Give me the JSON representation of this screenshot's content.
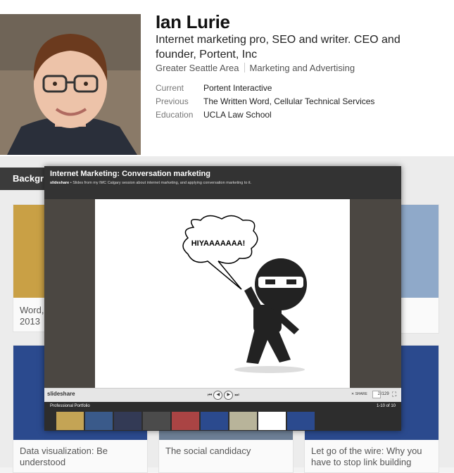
{
  "profile": {
    "name": "Ian Lurie",
    "headline": "Internet marketing pro, SEO and writer. CEO and founder, Portent, Inc",
    "location": "Greater Seattle Area",
    "industry": "Marketing and Advertising",
    "facts": [
      {
        "label": "Current",
        "value": "Portent Interactive"
      },
      {
        "label": "Previous",
        "value": "The Written Word, Cellular Technical Services"
      },
      {
        "label": "Education",
        "value": "UCLA Law School"
      }
    ]
  },
  "background": {
    "tab_label": "Backgr",
    "cards": [
      {
        "text": "Word, 2013"
      },
      {
        "text": "Data visualization: Be understood"
      },
      {
        "text": "The social candidacy"
      },
      {
        "text": "Let go of the wire: Why you have to stop link building"
      }
    ]
  },
  "slideshare": {
    "title": "Internet Marketing: Conversation marketing",
    "source": "slideshare",
    "description": "Slides from my IMC Calgary session about internet marketing, and applying conversation marketing to it.",
    "speech": "HIYAAAAAAA!",
    "brand": "slideshare",
    "share_label": "SHARE",
    "current_page": "2",
    "total_pages": "/129",
    "portfolio_title": "Professional Portfolio",
    "portfolio_count": "1-10 of 10"
  },
  "colors": {
    "overlay_bg": "#333333",
    "stage_bg": "#4b4742",
    "thumb_blue": "#2b4a8e"
  }
}
